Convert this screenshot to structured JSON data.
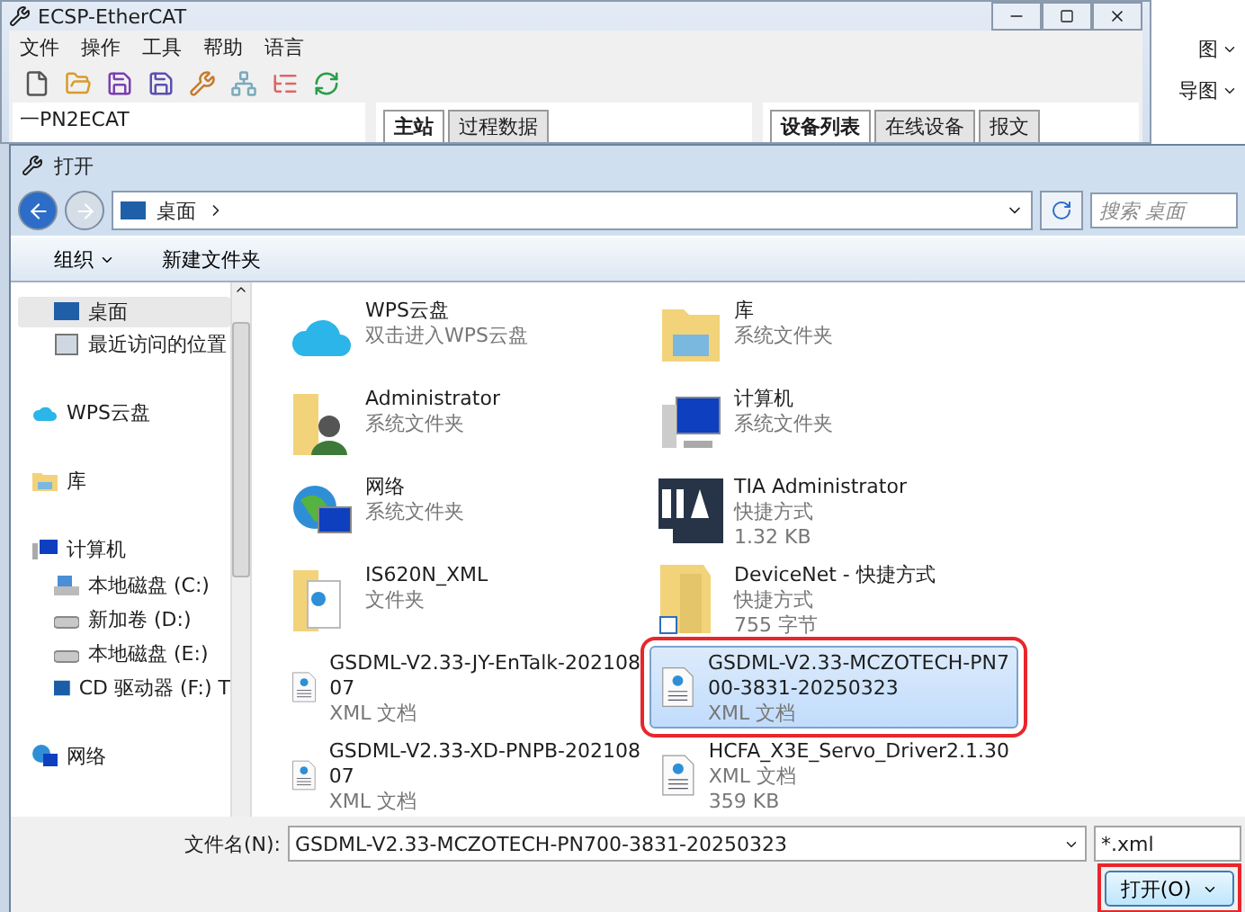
{
  "app_window": {
    "title": "ECSP-EtherCAT",
    "menu": [
      "文件",
      "操作",
      "工具",
      "帮助",
      "语言"
    ],
    "tree_root": "一PN2ECAT",
    "center_tabs": [
      {
        "label": "主站",
        "selected": true
      },
      {
        "label": "过程数据",
        "selected": false
      }
    ],
    "right_tabs": [
      {
        "label": "设备列表",
        "selected": true
      },
      {
        "label": "在线设备",
        "selected": false
      },
      {
        "label": "报文",
        "selected": false
      }
    ]
  },
  "side_window": {
    "items": [
      "图",
      "导图"
    ]
  },
  "dialog": {
    "title": "打开",
    "address": "桌面",
    "search": {
      "placeholder": "搜索 桌面"
    },
    "commands": [
      {
        "label": "组织",
        "dropdown": true
      },
      {
        "label": "新建文件夹",
        "dropdown": false
      }
    ],
    "favorites": [
      {
        "label": "桌面",
        "kind": "desktop",
        "selected": true
      },
      {
        "label": "最近访问的位置",
        "kind": "recent",
        "selected": false
      }
    ],
    "places": [
      {
        "label": "WPS云盘",
        "kind": "cloud",
        "selected": false
      },
      {
        "label": "库",
        "kind": "library",
        "selected": false
      },
      {
        "label": "计算机",
        "kind": "computer",
        "selected": false,
        "children": [
          {
            "label": "本地磁盘 (C:)",
            "kind": "system-drive",
            "selected": false
          },
          {
            "label": "新加卷 (D:)",
            "kind": "drive",
            "selected": false
          },
          {
            "label": "本地磁盘 (E:)",
            "kind": "drive",
            "selected": false
          },
          {
            "label": "CD 驱动器 (F:) T",
            "kind": "cd",
            "selected": false
          }
        ]
      },
      {
        "label": "网络",
        "kind": "network",
        "selected": false
      }
    ],
    "items": [
      {
        "name": [
          "WPS云盘"
        ],
        "details": [
          "双击进入WPS云盘"
        ],
        "kind": "cloud",
        "selected": false,
        "highlighted": false
      },
      {
        "name": [
          "库"
        ],
        "details": [
          "系统文件夹"
        ],
        "kind": "library",
        "selected": false,
        "highlighted": false
      },
      {
        "name": [
          "Administrator"
        ],
        "details": [
          "系统文件夹"
        ],
        "kind": "user-folder",
        "selected": false,
        "highlighted": false
      },
      {
        "name": [
          "计算机"
        ],
        "details": [
          "系统文件夹"
        ],
        "kind": "computer",
        "selected": false,
        "highlighted": false
      },
      {
        "name": [
          "网络"
        ],
        "details": [
          "系统文件夹"
        ],
        "kind": "network",
        "selected": false,
        "highlighted": false
      },
      {
        "name": [
          "TIA Administrator"
        ],
        "details": [
          "快捷方式",
          "1.32 KB"
        ],
        "kind": "tia",
        "selected": false,
        "highlighted": false
      },
      {
        "name": [
          "IS620N_XML"
        ],
        "details": [
          "文件夹"
        ],
        "kind": "folder",
        "selected": false,
        "highlighted": false
      },
      {
        "name": [
          "DeviceNet - 快捷方式"
        ],
        "details": [
          "快捷方式",
          "755 字节"
        ],
        "kind": "shortcut-folder",
        "selected": false,
        "highlighted": false
      },
      {
        "name": [
          "GSDML-V2.33-JY-EnTalk-202108",
          "07"
        ],
        "details": [
          "XML 文档"
        ],
        "kind": "xml",
        "selected": false,
        "highlighted": false
      },
      {
        "name": [
          "GSDML-V2.33-MCZOTECH-PN7",
          "00-3831-20250323"
        ],
        "details": [
          "XML 文档"
        ],
        "kind": "xml",
        "selected": true,
        "highlighted": true
      },
      {
        "name": [
          "GSDML-V2.33-XD-PNPB-202108",
          "07"
        ],
        "details": [
          "XML 文档"
        ],
        "kind": "xml",
        "selected": false,
        "highlighted": false
      },
      {
        "name": [
          "HCFA_X3E_Servo_Driver2.1.30"
        ],
        "details": [
          "XML 文档",
          "359 KB"
        ],
        "kind": "xml",
        "selected": false,
        "highlighted": false
      }
    ],
    "filename_label": "文件名(N):",
    "filename": "GSDML-V2.33-MCZOTECH-PN700-3831-20250323",
    "filter": "*.xml",
    "open_button": {
      "label": "打开(O)",
      "highlighted": true
    }
  }
}
